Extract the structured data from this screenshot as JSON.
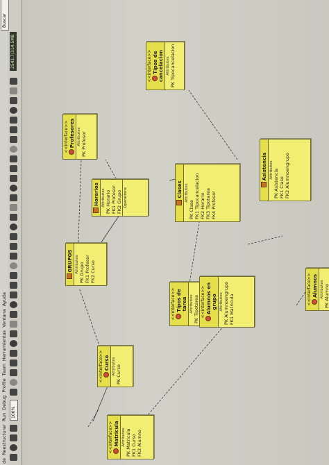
{
  "window": {
    "menu": [
      "de",
      "Reestructurar",
      "Run",
      "Debug",
      "Profile",
      "Team",
      "Herramientas",
      "Ventana",
      "Ayuda"
    ],
    "zoom": "100%",
    "search": "Buscar",
    "memory": "2541.7/314.5MB"
  },
  "diagram": {
    "boxes": [
      {
        "id": "matricula",
        "stereotype": "<<interface>>",
        "title": "Matricula",
        "section": "Attributes",
        "attrs": [
          "PK  Matricula",
          "FK1  Curso",
          "FK2  Alumno"
        ]
      },
      {
        "id": "curso",
        "stereotype": "<<interface>>",
        "title": "Curso",
        "section": "Attributes",
        "attrs": [
          "PK  Curso"
        ]
      },
      {
        "id": "grupos",
        "stereotype": "",
        "title": "GRUPOS",
        "section": "Attributes",
        "attrs": [
          "PK  Grupo",
          "FK1  Profesor",
          "FK2  Curso"
        ]
      },
      {
        "id": "tipos_tarea",
        "stereotype": "<<interface>>",
        "title": "Tipos de tarea",
        "section": "Attributes",
        "attrs": [
          "PK  Tipotarea"
        ]
      },
      {
        "id": "alumnos_grupo",
        "stereotype": "<<interface>>",
        "title": "Alumnos en grupo",
        "section": "Attributes",
        "attrs": [
          "PK  Alumnoengrupo",
          "FK1  Matricula"
        ]
      },
      {
        "id": "alumnos",
        "stereotype": "<<interface>>",
        "title": "Alumnos",
        "section": "Attributes",
        "attrs": [
          "PK  Alumno"
        ]
      },
      {
        "id": "profesores",
        "stereotype": "<<interface>>",
        "title": "Profesores",
        "section": "Attributes",
        "attrs": [
          "PK  Profesor"
        ]
      },
      {
        "id": "horarios",
        "stereotype": "",
        "title": "Horarios",
        "section": "Attributes",
        "attrs": [
          "PK  Horario",
          "FK1  Profesor",
          "FK2  Grupo"
        ],
        "ops": "Operations"
      },
      {
        "id": "clases",
        "stereotype": "",
        "title": "Clases",
        "section": "Attributes",
        "attrs": [
          "PK  Clase",
          "FK1  Tipocancelacion",
          "FK2  Horario",
          "FK3  Tipotarea",
          "FK4  Profesor"
        ]
      },
      {
        "id": "tipos_cancelacion",
        "stereotype": "<<interface>>",
        "title": "Tipos de cancelacion",
        "section": "Attributes",
        "attrs": [
          "PK  Tipocancelacion"
        ]
      },
      {
        "id": "asistencia",
        "stereotype": "",
        "title": "Asistencia",
        "section": "Attributes",
        "attrs": [
          "PK  Asistencia",
          "FK1  Clase",
          "FK2  Alumnoengrupo"
        ]
      }
    ]
  }
}
